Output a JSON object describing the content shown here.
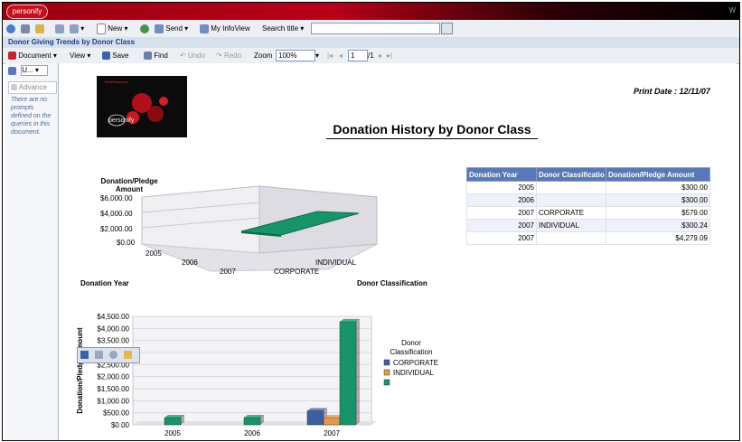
{
  "app": {
    "logo_text": "personify",
    "right_text": "W"
  },
  "toolbar1": {
    "new_label": "New",
    "send_label": "Send",
    "myinfoview_label": "My InfoView",
    "search_label": "Search title",
    "search_value": ""
  },
  "document": {
    "title": "Donor Giving Trends by Donor Class"
  },
  "toolbar2": {
    "document_label": "Document",
    "view_label": "View",
    "save_label": "Save",
    "find_label": "Find",
    "undo_label": "Undo",
    "redo_label": "Redo",
    "zoom_label": "Zoom",
    "zoom_value": "100%",
    "page_value": "1",
    "page_total": "/1"
  },
  "leftpanel": {
    "dropdown_label": "U...",
    "advanced_label": "Advance",
    "note": "There are no prompts defined on the queries in this document."
  },
  "report": {
    "print_date": "Print Date : 12/11/07",
    "title": "Donation History by Donor Class",
    "banner_top": "YourResources",
    "banner_brand": "personify"
  },
  "table": {
    "headers": [
      "Donation Year",
      "Donor Classificatio",
      "Donation/Pledge Amount"
    ],
    "rows": [
      {
        "year": "2005",
        "class": "",
        "amount": "$300.00"
      },
      {
        "year": "2006",
        "class": "",
        "amount": "$300.00"
      },
      {
        "year": "2007",
        "class": "CORPORATE",
        "amount": "$579.00"
      },
      {
        "year": "2007",
        "class": "INDIVIDUAL",
        "amount": "$300.24"
      },
      {
        "year": "2007",
        "class": "",
        "amount": "$4,279.09"
      }
    ]
  },
  "chart3d": {
    "ylabel": "Donation/Pledge Amount",
    "yticks": [
      "$6,000.00",
      "$4,000.00",
      "$2,000.00",
      "$0.00"
    ],
    "xticks": [
      "2005",
      "2006",
      "2007"
    ],
    "zticks": [
      "CORPORATE",
      "INDIVIDUAL"
    ],
    "xlabel": "Donation Year",
    "zlabel": "Donor Classification"
  },
  "chart_data": {
    "type": "bar",
    "title": "",
    "xlabel": "",
    "ylabel": "Donation/Pledge Amount",
    "categories": [
      "2005",
      "2006",
      "2007"
    ],
    "ylim": [
      0,
      4500
    ],
    "yticks": [
      "$4,500.00",
      "$4,000.00",
      "$3,500.00",
      "$3,000.00",
      "$2,500.00",
      "$2,000.00",
      "$1,500.00",
      "$1,000.00",
      "$500.00",
      "$0.00"
    ],
    "legend_title": "Donor Classification",
    "legend_position": "right",
    "series": [
      {
        "name": "CORPORATE",
        "color": "#3d5f9e",
        "values": [
          0,
          0,
          579.0
        ]
      },
      {
        "name": "INDIVIDUAL",
        "color": "#e29a4e",
        "values": [
          0,
          0,
          300.24
        ]
      },
      {
        "name": "",
        "color": "#17946a",
        "values": [
          300.0,
          300.0,
          4279.09
        ]
      }
    ]
  }
}
